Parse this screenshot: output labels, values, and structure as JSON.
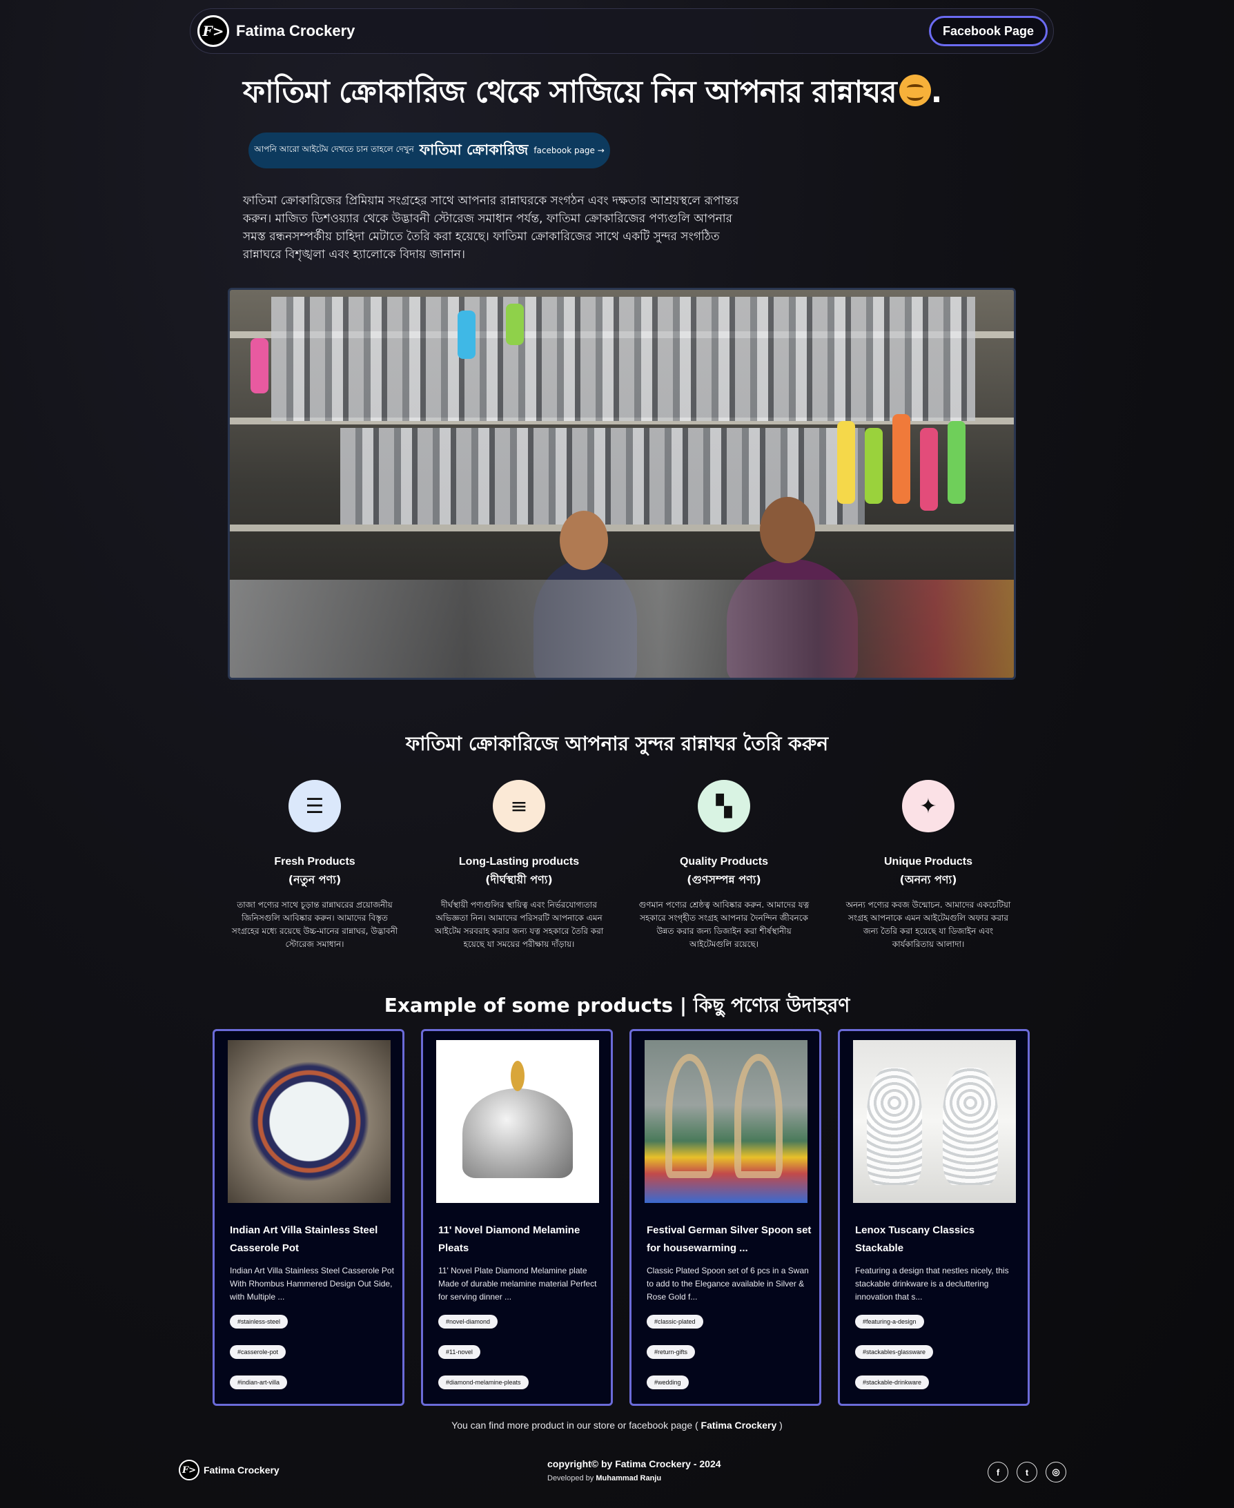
{
  "nav": {
    "logo_glyph": "F>",
    "brand": "Fatima Crockery",
    "facebook_button": "Facebook Page"
  },
  "hero": {
    "title": "ফাতিমা ক্রোকারিজ থেকে সাজিয়ে নিন আপনার রান্নাঘর",
    "title_suffix": ".",
    "pill_small": "আপনি আরো আইটেম দেখতে চান তাহলে দেখুন",
    "pill_big": "ফাতিমা ক্রোকারিজ",
    "pill_link": "facebook page →",
    "description": "ফাতিমা ক্রোকারিজের প্রিমিয়াম সংগ্রহের সাথে আপনার রান্নাঘরকে সংগঠন এবং দক্ষতার আশ্রয়স্থলে রূপান্তর করুন। মাজিত ডিশওয়্যার থেকে উদ্ভাবনী স্টোরেজ সমাধান পর্যন্ত, ফাতিমা ক্রোকারিজের পণ্যগুলি আপনার সমস্ত রন্ধনসম্পর্কীয় চাহিদা মেটাতে তৈরি করা হয়েছে। ফাতিমা ক্রোকারিজের সাথে একটি সুন্দর সংগঠিত রান্নাঘরে বিশৃঙ্খলা এবং হ্যালোকে বিদায় জানান।"
  },
  "features": {
    "title": "ফাতিমা ক্রোকারিজে আপনার সুন্দর রান্নাঘর তৈরি করুন",
    "items": [
      {
        "icon": "sliders-icon",
        "glyph": "☰",
        "color": "#dbe8fb",
        "title": "Fresh Products",
        "subtitle": "(নতুন পণ্য)",
        "desc": "তাজা পণ্যের সাথে চূড়ান্ত রান্নাঘরের প্রয়োজনীয় জিনিসগুলি আবিষ্কার করুন। আমাদের বিস্তৃত সংগ্রহের মধ্যে রয়েছে উচ্চ-মানের রান্নাঘর, উদ্ভাবনী স্টোরেজ সমাধান।"
      },
      {
        "icon": "stack-icon",
        "glyph": "≡",
        "color": "#fbe9d6",
        "title": "Long-Lasting products",
        "subtitle": "(দীর্ঘস্থায়ী পণ্য)",
        "desc": "দীর্ঘস্থায়ী পণ্যগুলির স্থায়িত্ব এবং নির্ভরযোগ্যতার অভিজ্ঞতা নিন। আমাদের পরিসরটি আপনাকে এমন আইটেম সরবরাহ করার জন্য যত্ন সহকারে তৈরি করা হয়েছে যা সময়ের পরীক্ষায় দাঁড়ায়।"
      },
      {
        "icon": "grid-icon",
        "glyph": "▚",
        "color": "#d9f3e3",
        "title": "Quality Products",
        "subtitle": "(গুণসম্পন্ন পণ্য)",
        "desc": "গুণমান পণ্যের শ্রেষ্ঠত্ব আবিষ্কার করুন. আমাদের যত্ন সহকারে সংগৃহীত সংগ্রহ আপনার দৈনন্দিন জীবনকে উন্নত করার জন্য ডিজাইন করা শীর্ষস্থানীয় আইটেমগুলি রয়েছে।"
      },
      {
        "icon": "sparkle-icon",
        "glyph": "✦",
        "color": "#fbe1e6",
        "title": "Unique Products",
        "subtitle": "(অনন্য পণ্য)",
        "desc": "অনন্য পণ্যের কবজ উন্মোচন. আমাদের একচেটিয়া সংগ্রহ আপনাকে এমন আইটেমগুলি অফার করার জন্য তৈরি করা হয়েছে যা ডিজাইন এবং কার্যকারিতায় আলাদা।"
      }
    ]
  },
  "products": {
    "title": "Example of some products | কিছু পণ্যের উদাহরণ",
    "items": [
      {
        "title": "Indian Art Villa Stainless Steel Casserole Pot",
        "desc": "Indian Art Villa Stainless Steel Casserole Pot With Rhombus Hammered Design Out Side, with Multiple ...",
        "tags": [
          "#stainless-steel",
          "#casserole-pot",
          "#indian-art-villa"
        ]
      },
      {
        "title": "11' Novel Diamond Melamine Pleats",
        "desc": "11' Novel Plate Diamond Melamine plate Made of durable melamine material Perfect for serving dinner ...",
        "tags": [
          "#novel-diamond",
          "#11-novel",
          "#diamond-melamine-pleats"
        ]
      },
      {
        "title": "Festival German Silver Spoon set for housewarming ...",
        "desc": "Classic Plated Spoon set of 6 pcs in a Swan to add to the Elegance available in Silver & Rose Gold f...",
        "tags": [
          "#classic-plated",
          "#return-gifts",
          "#wedding"
        ]
      },
      {
        "title": "Lenox Tuscany Classics Stackable",
        "desc": "Featuring a design that nestles nicely, this stackable drinkware is a decluttering innovation that s...",
        "tags": [
          "#featuring-a-design",
          "#stackables-glassware",
          "#stackable-drinkware"
        ]
      }
    ],
    "more_text": "You can find more product in our store or facebook page (",
    "more_brand": "Fatima Crockery",
    "more_end": ")"
  },
  "footer": {
    "brand": "Fatima Crockery",
    "copyright": "copyright© by Fatima Crockery - 2024",
    "developed_label": "Developed by",
    "developer": "Muhammad Ranju",
    "social": [
      {
        "name": "facebook-icon",
        "glyph": "f"
      },
      {
        "name": "twitter-icon",
        "glyph": "t"
      },
      {
        "name": "instagram-icon",
        "glyph": "◎"
      }
    ]
  }
}
